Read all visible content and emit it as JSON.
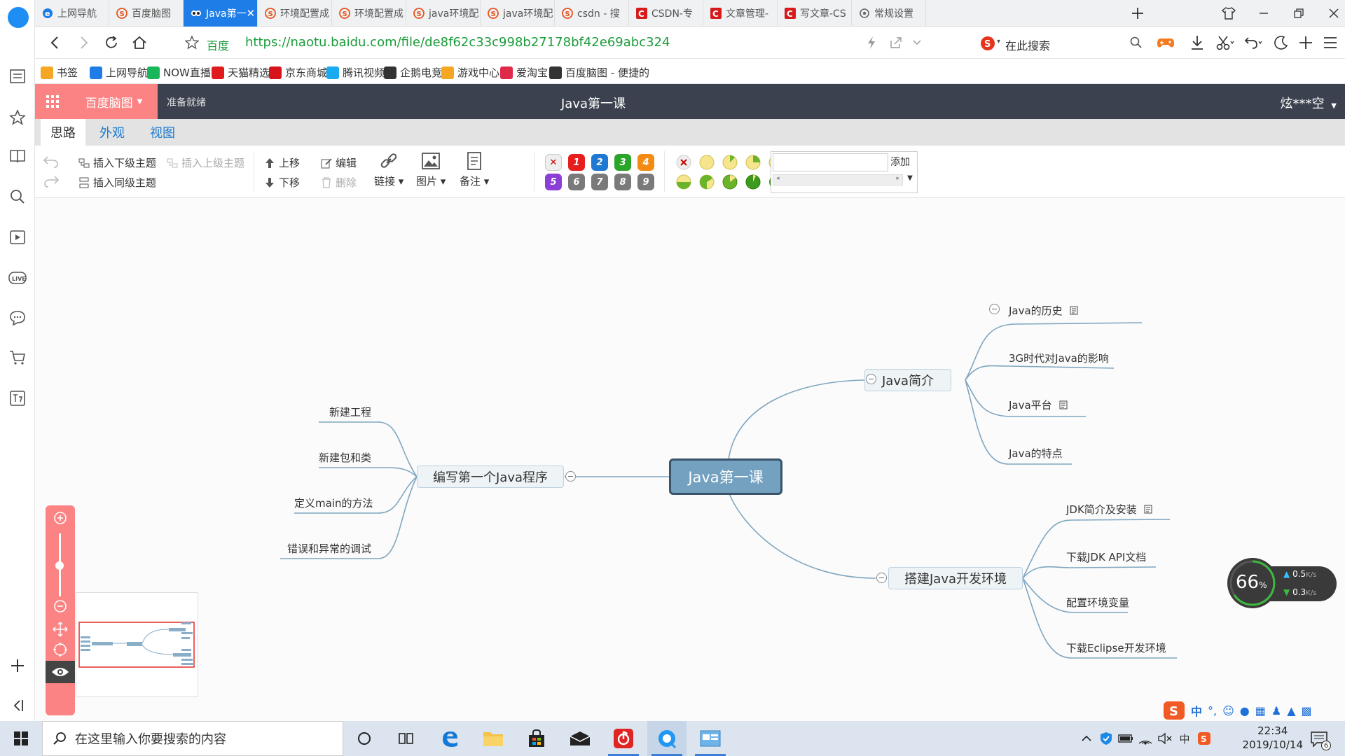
{
  "browser": {
    "tabs": [
      {
        "label": "上网导航",
        "icon": "ie-icon"
      },
      {
        "label": "百度脑图",
        "icon": "sogou-icon"
      },
      {
        "label": "Java第一",
        "icon": "owl-icon",
        "active": true
      },
      {
        "label": "环境配置成",
        "icon": "sogou-icon"
      },
      {
        "label": "环境配置成",
        "icon": "sogou-icon"
      },
      {
        "label": "java环境配",
        "icon": "sogou-icon"
      },
      {
        "label": "java环境配",
        "icon": "sogou-icon"
      },
      {
        "label": "csdn - 搜",
        "icon": "sogou-icon"
      },
      {
        "label": "CSDN-专",
        "icon": "csdn-icon"
      },
      {
        "label": "文章管理-",
        "icon": "csdn-icon"
      },
      {
        "label": "写文章-CS",
        "icon": "csdn-icon"
      },
      {
        "label": "常规设置",
        "icon": "gear-icon"
      }
    ],
    "address": {
      "site_label": "百度",
      "url": "https://naotu.baidu.com/file/de8f62c33c998b27178bf42e69abc324",
      "search_placeholder": "在此搜索"
    },
    "bookmarks": [
      {
        "label": "书签",
        "color": "#f5a623"
      },
      {
        "label": "上网导航",
        "color": "#1e7de6"
      },
      {
        "label": "NOW直播",
        "color": "#1bb55c"
      },
      {
        "label": "天猫精选",
        "color": "#e01b1b"
      },
      {
        "label": "京东商城",
        "color": "#d7141a"
      },
      {
        "label": "腾讯视频",
        "color": "#1aaaf0"
      },
      {
        "label": "企鹅电竞",
        "color": "#333333"
      },
      {
        "label": "游戏中心",
        "color": "#f5a623"
      },
      {
        "label": "爱淘宝",
        "color": "#e02a4a"
      },
      {
        "label": "百度脑图 - 便捷的",
        "color": "#333333"
      }
    ]
  },
  "app": {
    "brand": "百度脑图",
    "status": "准备就绪",
    "title": "Java第一课",
    "user": "炫***空",
    "menu_tabs": [
      "思路",
      "外观",
      "视图"
    ],
    "toolbar": {
      "insert_child": "插入下级主题",
      "insert_parent": "插入上级主题",
      "insert_sibling": "插入同级主题",
      "move_up": "上移",
      "move_down": "下移",
      "edit": "编辑",
      "delete": "删除",
      "link": "链接",
      "image": "图片",
      "note": "备注",
      "resource_add": "添加",
      "priorities": [
        "1",
        "2",
        "3",
        "4",
        "5",
        "6",
        "7",
        "8",
        "9"
      ]
    }
  },
  "mindmap": {
    "root": "Java第一课",
    "right_top": {
      "label": "Java简介",
      "children": [
        "Java的历史",
        "3G时代对Java的影响",
        "Java平台",
        "Java的特点"
      ]
    },
    "right_bottom": {
      "label": "搭建Java开发环境",
      "children": [
        "JDK简介及安装",
        "下载JDK API文档",
        "配置环境变量",
        "下载Eclipse开发环境"
      ]
    },
    "left": {
      "label": "编写第一个Java程序",
      "children": [
        "新建工程",
        "新建包和类",
        "定义main的方法",
        "错误和异常的调试"
      ]
    }
  },
  "netspeed": {
    "percent": "66",
    "unit": "%",
    "up": "0.5",
    "down": "0.3",
    "rate_unit": "K/s"
  },
  "taskbar": {
    "search_placeholder": "在这里输入你要搜索的内容",
    "time": "22:34",
    "date": "2019/10/14",
    "notification_count": "6",
    "ime_lang": "中"
  }
}
